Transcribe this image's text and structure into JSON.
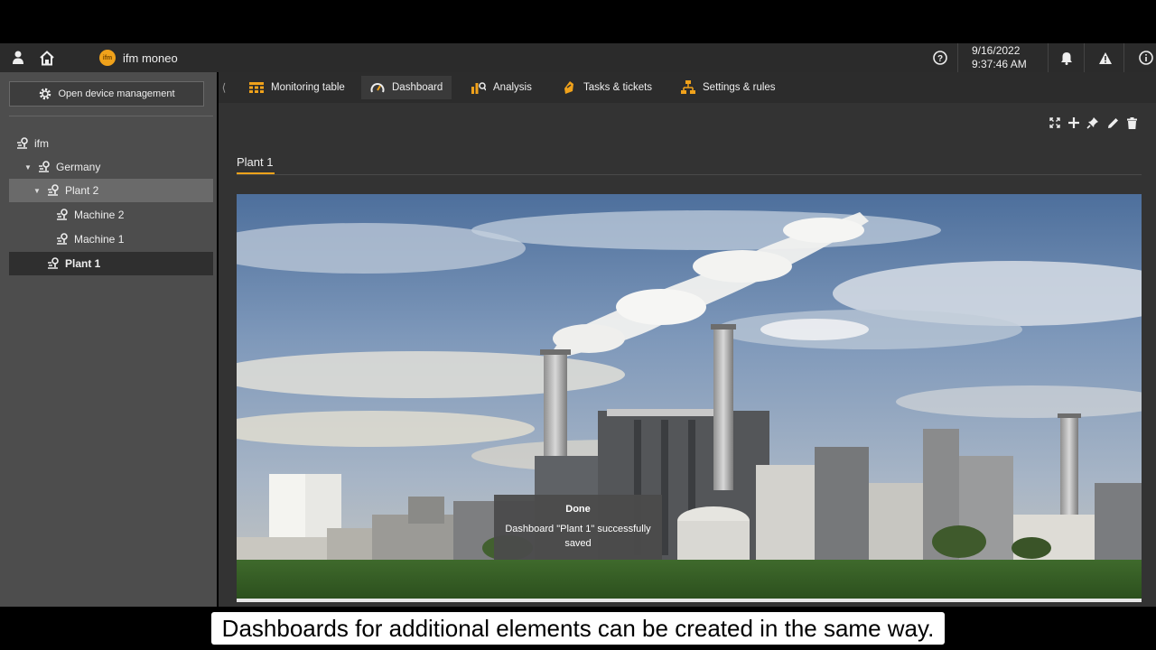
{
  "app": {
    "name": "ifm moneo",
    "logo_text": "ifm"
  },
  "header": {
    "date": "9/16/2022",
    "time": "9:37:46 AM"
  },
  "sidebar": {
    "open_device_label": "Open device management",
    "tree": [
      {
        "label": "ifm",
        "level": 0
      },
      {
        "label": "Germany",
        "level": 1,
        "expanded": true
      },
      {
        "label": "Plant 2",
        "level": 2,
        "expanded": true,
        "state": "hover"
      },
      {
        "label": "Machine 2",
        "level": 3
      },
      {
        "label": "Machine 1",
        "level": 3
      },
      {
        "label": "Plant 1",
        "level": 2,
        "state": "selected"
      }
    ]
  },
  "tabs": [
    {
      "label": "Monitoring table",
      "icon": "table-icon"
    },
    {
      "label": "Dashboard",
      "icon": "gauge-icon",
      "active": true
    },
    {
      "label": "Analysis",
      "icon": "chart-icon"
    },
    {
      "label": "Tasks & tickets",
      "icon": "ticket-icon"
    },
    {
      "label": "Settings & rules",
      "icon": "settings-tree-icon"
    }
  ],
  "dashboard": {
    "page_tab": "Plant 1"
  },
  "toast": {
    "title": "Done",
    "message": "Dashboard \"Plant 1\" successfully saved"
  },
  "caption": "Dashboards for additional elements can be created in the same way.",
  "colors": {
    "accent": "#f0a21b",
    "sidebar": "#4d4d4d",
    "topbar": "#2b2b2b",
    "main": "#333333"
  }
}
